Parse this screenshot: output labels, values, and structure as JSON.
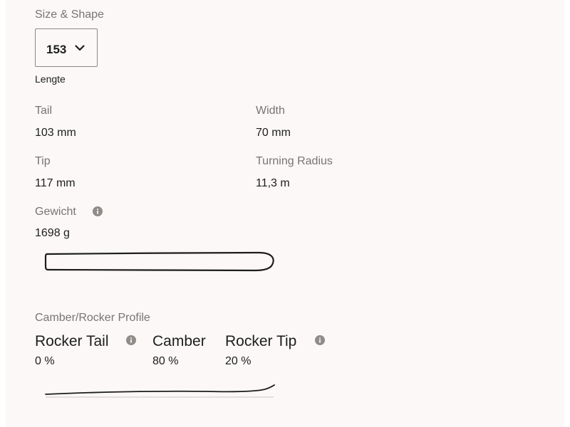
{
  "size_shape": {
    "title": "Size & Shape",
    "length_select": {
      "value": "153",
      "icon": "chevron-down-icon"
    },
    "length_caption": "Lengte"
  },
  "specs": {
    "tail": {
      "label": "Tail",
      "value": "103 mm"
    },
    "width": {
      "label": "Width",
      "value": "70 mm"
    },
    "tip": {
      "label": "Tip",
      "value": "117 mm"
    },
    "turning_radius": {
      "label": "Turning Radius",
      "value": "11,3 m"
    },
    "weight": {
      "label": "Gewicht",
      "value": "1698 g",
      "icon": "info-icon"
    }
  },
  "camber_rocker": {
    "title": "Camber/Rocker Profile",
    "rocker_tail": {
      "name": "Rocker Tail",
      "value": "0 %",
      "icon": "info-icon"
    },
    "camber": {
      "name": "Camber",
      "value": "80 %"
    },
    "rocker_tip": {
      "name": "Rocker Tip",
      "value": "20 %",
      "icon": "info-icon"
    }
  },
  "colors": {
    "background": "#fbf8f7",
    "label_gray": "#777472",
    "text": "#1d1d1d",
    "icon_gray": "#8f8c8a"
  }
}
